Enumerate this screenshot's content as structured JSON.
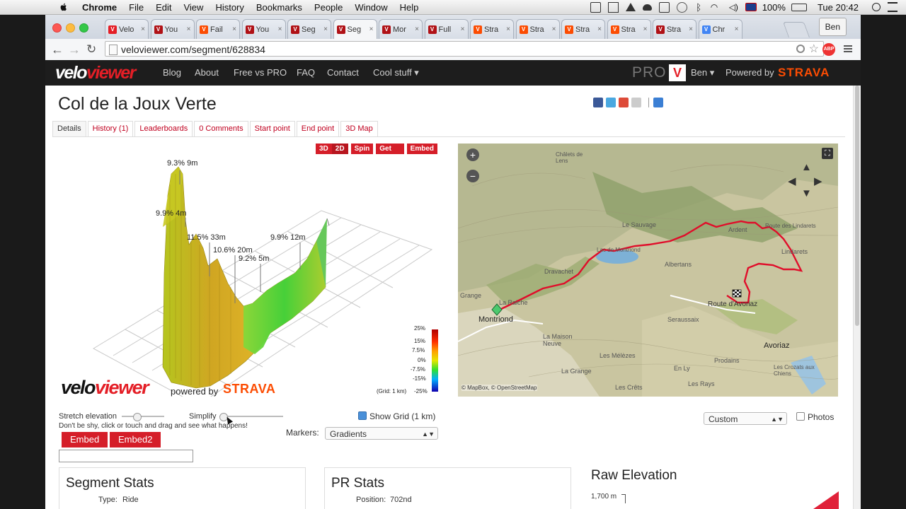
{
  "menubar": {
    "app": "Chrome",
    "items": [
      "File",
      "Edit",
      "View",
      "History",
      "Bookmarks",
      "People",
      "Window",
      "Help"
    ],
    "battery": "100%",
    "clock": "Tue 20:42"
  },
  "browser": {
    "tabs": [
      {
        "title": "Velo",
        "color": "#e41e26"
      },
      {
        "title": "You",
        "color": "#b01116"
      },
      {
        "title": "Fail",
        "color": "#fc4c02"
      },
      {
        "title": "You",
        "color": "#b01116"
      },
      {
        "title": "Seg",
        "color": "#b01116"
      },
      {
        "title": "Seg",
        "color": "#b01116",
        "active": true
      },
      {
        "title": "Mor",
        "color": "#b01116"
      },
      {
        "title": "Full",
        "color": "#b01116"
      },
      {
        "title": "Stra",
        "color": "#fc4c02"
      },
      {
        "title": "Stra",
        "color": "#fc4c02"
      },
      {
        "title": "Stra",
        "color": "#fc4c02"
      },
      {
        "title": "Stra",
        "color": "#fc4c02"
      },
      {
        "title": "Stra",
        "color": "#b01116"
      },
      {
        "title": "Chr",
        "color": "#4285f4"
      }
    ],
    "profile": "Ben",
    "url": "veloviewer.com/segment/628834"
  },
  "site": {
    "logo_a": "velo",
    "logo_b": "viewer",
    "nav": [
      "Blog",
      "About",
      "Free vs PRO",
      "FAQ",
      "Contact",
      "Cool stuff ▾"
    ],
    "pro": "PRO",
    "user": "Ben ▾",
    "powered_by": "Powered by",
    "strava": "STRAVA"
  },
  "page": {
    "title": "Col de la Joux Verte",
    "tabs": [
      "Details",
      "History (1)",
      "Leaderboards",
      "0 Comments",
      "Start point",
      "End point",
      "3D Map"
    ]
  },
  "viz": {
    "buttons": [
      "3D",
      "2D",
      "Spin",
      "Get image",
      "Embed"
    ],
    "annotations": [
      "9.3% 9m",
      "9.9% 4m",
      "11.5% 33m",
      "10.6% 20m",
      "9.2% 5m",
      "9.9% 12m"
    ],
    "legend": [
      "25%",
      "15%",
      "7.5%",
      "0%",
      "-7.5%",
      "-15%",
      "-25%"
    ],
    "grid_note": "(Grid: 1 km)",
    "wm_a": "velo",
    "wm_b": "viewer",
    "wm_powered": "powered by",
    "wm_strava": "STRAVA",
    "stretch": "Stretch elevation",
    "simplify": "Simplify",
    "hint": "Don't be shy, click or touch and drag and see what happens!",
    "show_grid": "Show Grid (1 km)",
    "markers_label": "Markers:",
    "markers_value": "Gradients",
    "embed": "Embed",
    "embed2": "Embed2",
    "embed_code": ""
  },
  "map": {
    "places": [
      "Châlets de Lens",
      "Le Sauvage",
      "Ardent",
      "Route des Lindarets",
      "Lac de Montriond",
      "Albertans",
      "Dravachet",
      "Lindarets",
      "Montriond",
      "La Raiche",
      "Route d'Avoriaz",
      "Seraussaix",
      "La Maison Neuve",
      "Les Mélèzes",
      "La Grange",
      "Avoriaz",
      "Prodains",
      "En Ly",
      "Les Rays",
      "Les Crêts",
      "Les Crozats aux Chiens",
      "Grange"
    ],
    "attribution": "© MapBox, © OpenStreetMap",
    "layer": "Custom",
    "photos": "Photos"
  },
  "panels": {
    "segment_stats": "Segment Stats",
    "type_label": "Type:",
    "type_value": "Ride",
    "pr_stats": "PR Stats",
    "position_label": "Position:",
    "position_value": "702nd",
    "raw_elevation": "Raw Elevation",
    "elev_tick": "1,700 m"
  }
}
